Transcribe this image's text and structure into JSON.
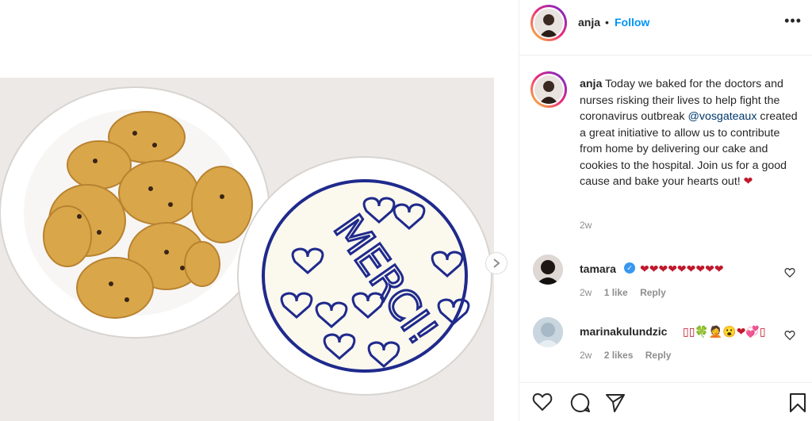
{
  "post": {
    "username": "anja",
    "separator": "•",
    "follow_label": "Follow",
    "more_label": "•••",
    "caption_text": "Today we baked for the doctors and nurses risking their lives to help fight the coronavirus outbreak",
    "mention": "@vosgateaux",
    "caption_text_2": "created a great initiative to allow us to contribute from home by delivering our cake and cookies to the hospital. Join us for a good cause and bake your hearts out!",
    "caption_emoji": "❤",
    "caption_time": "2w"
  },
  "comments": [
    {
      "username": "tamara",
      "text": "❤❤❤❤❤❤❤❤❤",
      "time": "2w",
      "likes": "1 like",
      "reply": "Reply",
      "verified": true
    },
    {
      "username": "marinakulundzic",
      "text": "▯▯🍀🤦😮❤💞▯",
      "time": "2w",
      "likes": "2 likes",
      "reply": "Reply",
      "verified": false
    }
  ],
  "image": {
    "cake_text": "MERCI!",
    "colors": {
      "background": "#ece9e7",
      "plate": "#ffffff",
      "icing_lines": "#1f2a8c",
      "cookie": "#d9a74a"
    }
  },
  "colors": {
    "follow": "#0095f6",
    "mention": "#00376b",
    "heart": "#c0182b",
    "meta": "#8e8e8e"
  }
}
